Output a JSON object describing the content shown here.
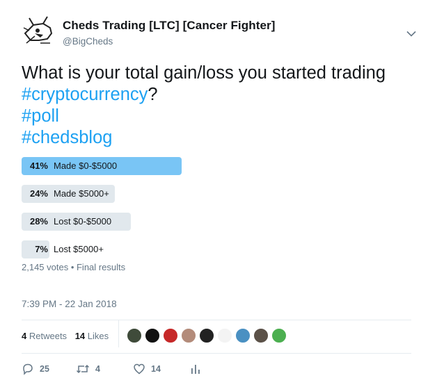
{
  "author": {
    "display_name": "Cheds Trading [LTC] [Cancer Fighter]",
    "handle": "@BigCheds",
    "avatar_icon": "bull-sketch-avatar"
  },
  "tweet": {
    "text_before": "What is your total gain/loss you started trading ",
    "hashtag_1": "#cryptocurrency",
    "text_after": "?",
    "hashtag_2": "#poll",
    "hashtag_3": "#chedsblog"
  },
  "poll": {
    "options": [
      {
        "percent_label": "41%",
        "label": "Made $0-$5000",
        "share": 0.41,
        "winner": true
      },
      {
        "percent_label": "24%",
        "label": "Made $5000+",
        "share": 0.24,
        "winner": false
      },
      {
        "percent_label": "28%",
        "label": "Lost $0-$5000",
        "share": 0.28,
        "winner": false
      },
      {
        "percent_label": "7%",
        "label": "Lost $5000+",
        "share": 0.07,
        "winner": false
      }
    ],
    "meta": "2,145 votes • Final results"
  },
  "timestamp": "7:39 PM - 22 Jan 2018",
  "stats": {
    "retweets_count": "4",
    "retweets_label": "Retweets",
    "likes_count": "14",
    "likes_label": "Likes"
  },
  "likers": [
    {
      "color": "#3f4b3a"
    },
    {
      "color": "#111111"
    },
    {
      "color": "#c62828"
    },
    {
      "color": "#b38b7a"
    },
    {
      "color": "#222222"
    },
    {
      "color": "#f3f3f3"
    },
    {
      "color": "#4a90c2"
    },
    {
      "color": "#5b5148"
    },
    {
      "color": "#4caf50"
    }
  ],
  "actions": {
    "replies": "25",
    "retweets": "4",
    "likes": "14"
  },
  "colors": {
    "accent": "#1da1f2",
    "poll_winner": "#79c5f5",
    "poll_other": "#e1e8ed",
    "muted": "#657786"
  }
}
